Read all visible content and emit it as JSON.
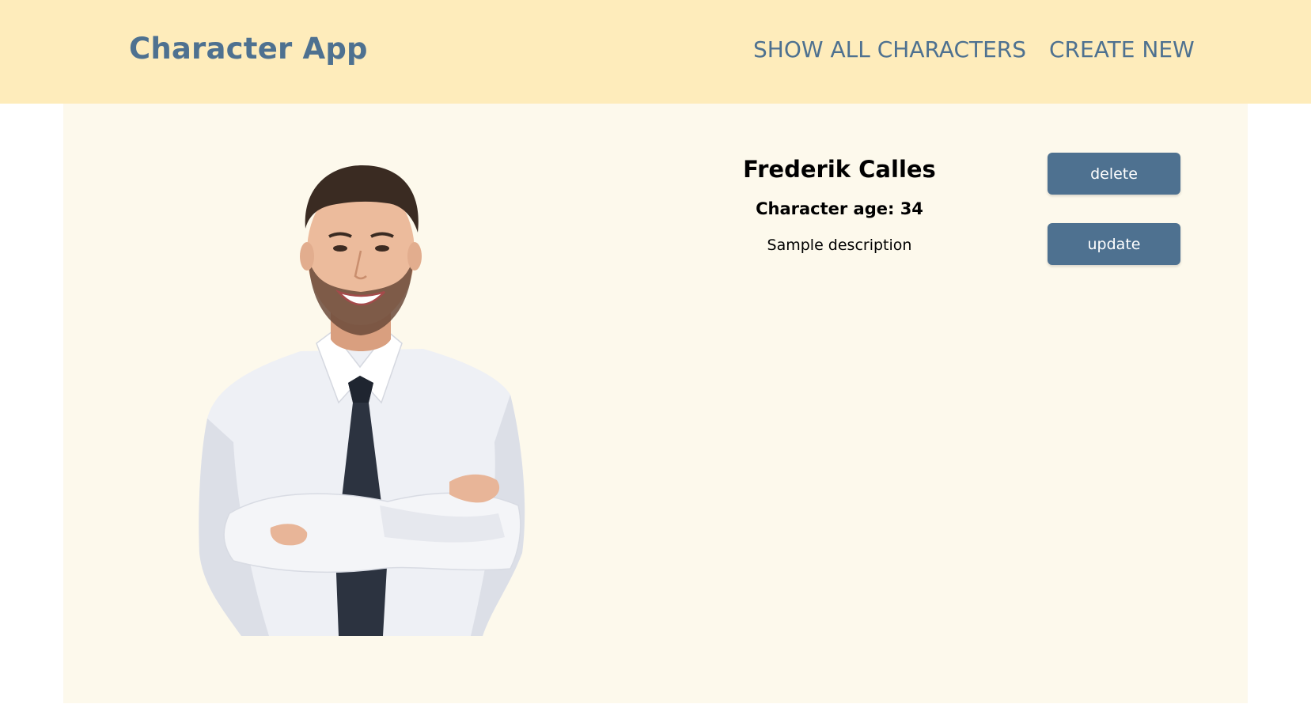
{
  "navbar": {
    "brand": "Character App",
    "links": [
      {
        "label": "SHOW ALL CHARACTERS"
      },
      {
        "label": "CREATE NEW"
      }
    ]
  },
  "character": {
    "name": "Frederik Calles",
    "age_text": "Character age: 34",
    "description": "Sample description"
  },
  "actions": {
    "delete_label": "delete",
    "update_label": "update"
  },
  "colors": {
    "navbar_bg": "#feecbb",
    "content_bg": "#fdf9ec",
    "accent": "#4e7190"
  }
}
